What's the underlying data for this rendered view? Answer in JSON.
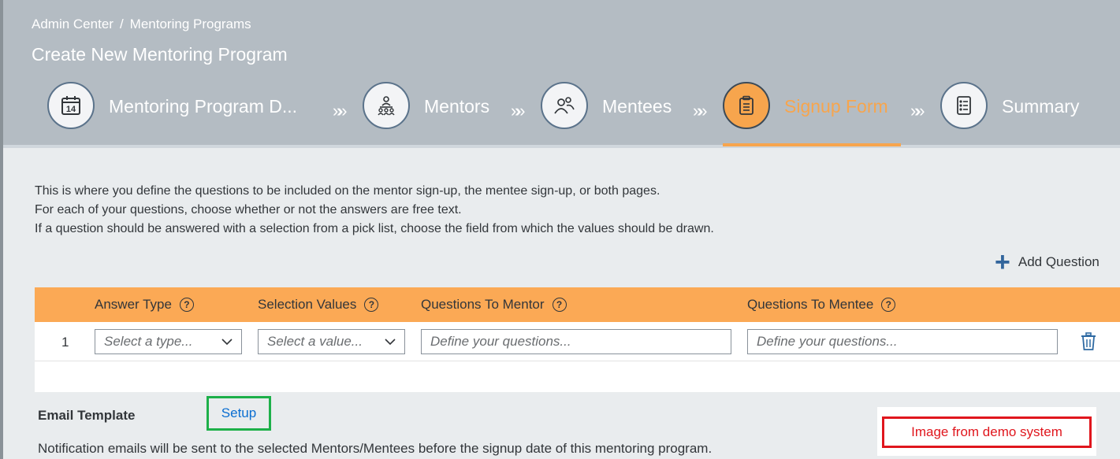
{
  "breadcrumb": {
    "item1": "Admin Center",
    "separator": "/",
    "item2": "Mentoring Programs"
  },
  "page_title": "Create New Mentoring Program",
  "steps": [
    {
      "label": "Mentoring Program D...",
      "icon": "calendar-icon",
      "calendar_day": "14",
      "active": false
    },
    {
      "label": "Mentors",
      "icon": "group-icon",
      "active": false
    },
    {
      "label": "Mentees",
      "icon": "people-icon",
      "active": false
    },
    {
      "label": "Signup Form",
      "icon": "clipboard-icon",
      "active": true
    },
    {
      "label": "Summary",
      "icon": "checklist-icon",
      "active": false
    }
  ],
  "step_separator": "»»",
  "description": {
    "line1": "This is where you define the questions to be included on the mentor sign-up, the mentee sign-up, or both pages.",
    "line2": "For each of your questions, choose whether or not the answers are free text.",
    "line3": "If a question should be answered with a selection from a pick list, choose the field from which the values should be drawn."
  },
  "add_question_label": "Add Question",
  "table": {
    "columns": {
      "answer_type": "Answer Type",
      "selection_values": "Selection Values",
      "questions_to_mentor": "Questions To Mentor",
      "questions_to_mentee": "Questions To Mentee"
    },
    "help_glyph": "?",
    "rows": [
      {
        "number": "1",
        "answer_type_placeholder": "Select a type...",
        "selection_values_placeholder": "Select a value...",
        "mentor_question_placeholder": "Define your questions...",
        "mentee_question_placeholder": "Define your questions..."
      }
    ]
  },
  "email_template": {
    "label": "Email Template",
    "setup_link": "Setup",
    "notice": "Notification emails will be sent to the selected Mentors/Mentees before the signup date of this mentoring program."
  },
  "watermark_text": "Image from demo system",
  "colors": {
    "header_bg": "#b4bcc3",
    "accent_orange": "#f7a54d",
    "table_header": "#fba955",
    "link_blue": "#0a6ed1",
    "highlight_green": "#1db049",
    "watermark_red": "#e0161d"
  }
}
